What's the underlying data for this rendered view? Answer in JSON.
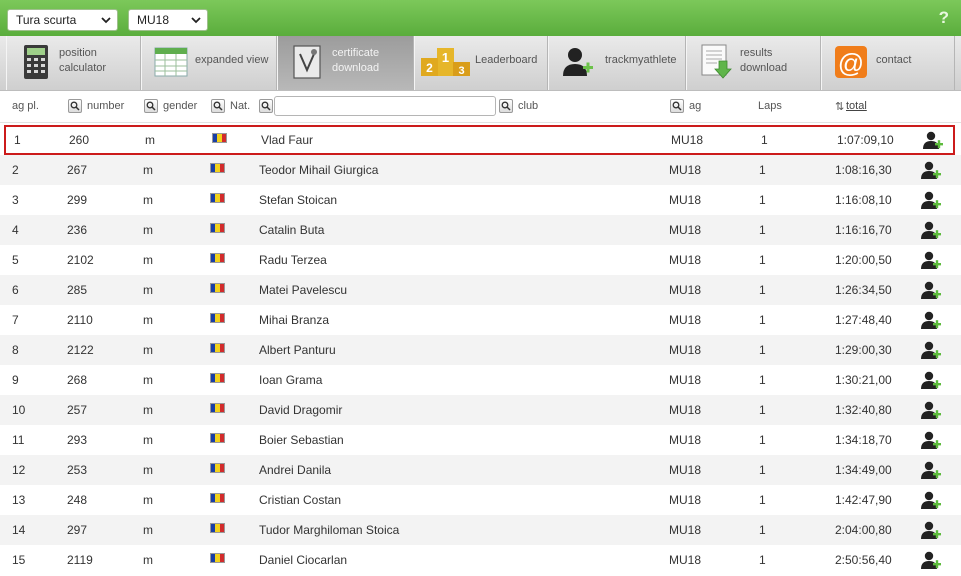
{
  "filters": {
    "race": "Tura scurta",
    "category": "MU18"
  },
  "help_symbol": "?",
  "toolbar": [
    {
      "icon": "calculator-icon",
      "line1": "position",
      "line2": "calculator",
      "active": false
    },
    {
      "icon": "spreadsheet-icon",
      "line1": "expanded view",
      "line2": "",
      "active": false
    },
    {
      "icon": "certificate-icon",
      "line1": "certificate",
      "line2": "download",
      "active": true
    },
    {
      "icon": "podium-icon",
      "line1": "Leaderboard",
      "line2": "",
      "active": false
    },
    {
      "icon": "add-athlete-icon",
      "line1": "trackmyathlete",
      "line2": "",
      "active": false
    },
    {
      "icon": "download-results-icon",
      "line1": "results",
      "line2": "download",
      "active": false
    },
    {
      "icon": "at-sign-icon",
      "line1": "contact",
      "line2": "",
      "active": false
    }
  ],
  "podium_numbers": [
    "2",
    "1",
    "3"
  ],
  "contact_symbol": "@",
  "columns": {
    "place": "ag pl.",
    "number": "number",
    "gender": "gender",
    "nat": "Nat.",
    "club": "club",
    "ag": "ag",
    "laps": "Laps",
    "total": "total",
    "sort_symbol": "⇅"
  },
  "search_placeholder": "",
  "flag_colors": [
    "#1a3fa6",
    "#f2d21b",
    "#d22b2b"
  ],
  "rows": [
    {
      "place": "1",
      "number": "260",
      "gender": "m",
      "name": "Vlad Faur",
      "ag": "MU18",
      "laps": "1",
      "total": "1:07:09,10"
    },
    {
      "place": "2",
      "number": "267",
      "gender": "m",
      "name": "Teodor Mihail Giurgica",
      "ag": "MU18",
      "laps": "1",
      "total": "1:08:16,30"
    },
    {
      "place": "3",
      "number": "299",
      "gender": "m",
      "name": "Stefan Stoican",
      "ag": "MU18",
      "laps": "1",
      "total": "1:16:08,10"
    },
    {
      "place": "4",
      "number": "236",
      "gender": "m",
      "name": "Catalin Buta",
      "ag": "MU18",
      "laps": "1",
      "total": "1:16:16,70"
    },
    {
      "place": "5",
      "number": "2102",
      "gender": "m",
      "name": "Radu Terzea",
      "ag": "MU18",
      "laps": "1",
      "total": "1:20:00,50"
    },
    {
      "place": "6",
      "number": "285",
      "gender": "m",
      "name": "Matei Pavelescu",
      "ag": "MU18",
      "laps": "1",
      "total": "1:26:34,50"
    },
    {
      "place": "7",
      "number": "2110",
      "gender": "m",
      "name": "Mihai Branza",
      "ag": "MU18",
      "laps": "1",
      "total": "1:27:48,40"
    },
    {
      "place": "8",
      "number": "2122",
      "gender": "m",
      "name": "Albert Panturu",
      "ag": "MU18",
      "laps": "1",
      "total": "1:29:00,30"
    },
    {
      "place": "9",
      "number": "268",
      "gender": "m",
      "name": "Ioan Grama",
      "ag": "MU18",
      "laps": "1",
      "total": "1:30:21,00"
    },
    {
      "place": "10",
      "number": "257",
      "gender": "m",
      "name": "David Dragomir",
      "ag": "MU18",
      "laps": "1",
      "total": "1:32:40,80"
    },
    {
      "place": "11",
      "number": "293",
      "gender": "m",
      "name": "Boier Sebastian",
      "ag": "MU18",
      "laps": "1",
      "total": "1:34:18,70"
    },
    {
      "place": "12",
      "number": "253",
      "gender": "m",
      "name": "Andrei Danila",
      "ag": "MU18",
      "laps": "1",
      "total": "1:34:49,00"
    },
    {
      "place": "13",
      "number": "248",
      "gender": "m",
      "name": "Cristian Costan",
      "ag": "MU18",
      "laps": "1",
      "total": "1:42:47,90"
    },
    {
      "place": "14",
      "number": "297",
      "gender": "m",
      "name": "Tudor Marghiloman Stoica",
      "ag": "MU18",
      "laps": "1",
      "total": "2:04:00,80"
    },
    {
      "place": "15",
      "number": "2119",
      "gender": "m",
      "name": "Daniel Ciocarlan",
      "ag": "MU18",
      "laps": "1",
      "total": "2:50:56,40"
    }
  ]
}
